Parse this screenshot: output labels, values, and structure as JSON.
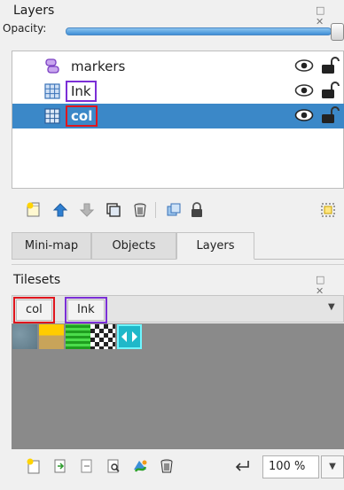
{
  "layers_panel": {
    "title": "Layers",
    "title_buttons": "□ ✕",
    "opacity_label": "Opacity:",
    "opacity_value": 1.0,
    "rows": [
      {
        "name": "markers",
        "icon": "object-layer-icon",
        "visible": true,
        "locked": false,
        "selected": false
      },
      {
        "name": "Ink",
        "icon": "tile-layer-icon",
        "visible": true,
        "locked": false,
        "selected": false
      },
      {
        "name": "col",
        "icon": "tile-layer-icon",
        "visible": true,
        "locked": false,
        "selected": true
      }
    ],
    "toolbar_icons": [
      "new-layer-icon",
      "raise-layer-icon",
      "lower-layer-icon",
      "duplicate-layer-icon",
      "delete-layer-icon",
      "toggle-other-layers-icon",
      "lock-layer-icon",
      "highlight-layer-icon"
    ]
  },
  "dock_tabs": [
    {
      "label": "Mini-map",
      "active": false
    },
    {
      "label": "Objects",
      "active": false
    },
    {
      "label": "Layers",
      "active": true
    }
  ],
  "tilesets_panel": {
    "title": "Tilesets",
    "title_buttons": "□ ✕",
    "tabs": [
      {
        "label": "col",
        "highlight": "#e0161d"
      },
      {
        "label": "Ink",
        "highlight": "#7b2fd6"
      }
    ],
    "dropdown_arrow": "▼",
    "tiles": [
      "stone-gray",
      "yellow-bar",
      "green-grid",
      "checkerboard",
      "cyan-arrows"
    ],
    "toolbar_icons": [
      "new-tileset-icon",
      "import-tileset-icon",
      "export-tileset-icon",
      "tileset-properties-icon",
      "edit-terrain-icon",
      "remove-tileset-icon"
    ],
    "dynamic_wrap_icon": "dynamic-wrap-icon",
    "zoom": "100 %",
    "zoom_arrow": "▼"
  },
  "colors": {
    "selection": "#3b88c8",
    "highlight_purple": "#7b2fd6",
    "highlight_red": "#e0161d",
    "tile_background": "#8a8a8a"
  }
}
